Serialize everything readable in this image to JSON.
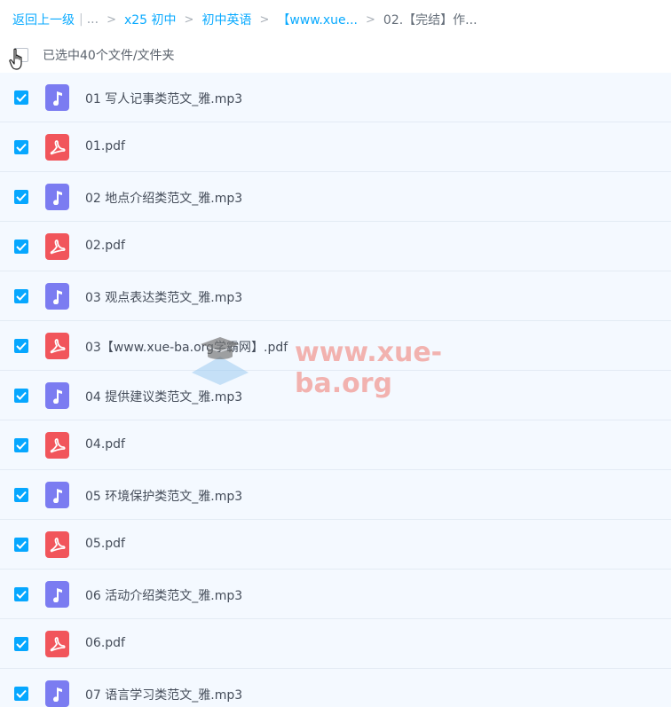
{
  "breadcrumb": {
    "back": "返回上一级",
    "ellipsis": "...",
    "items": [
      "x25 初中",
      "初中英语",
      "【www.xue..."
    ],
    "current": "02.【完结】作..."
  },
  "selection": {
    "text": "已选中40个文件/文件夹"
  },
  "files": [
    {
      "name": "01 写人记事类范文_雅.mp3",
      "type": "mp3"
    },
    {
      "name": "01.pdf",
      "type": "pdf"
    },
    {
      "name": "02 地点介绍类范文_雅.mp3",
      "type": "mp3"
    },
    {
      "name": "02.pdf",
      "type": "pdf"
    },
    {
      "name": "03 观点表达类范文_雅.mp3",
      "type": "mp3"
    },
    {
      "name": "03【www.xue-ba.org学霸网】.pdf",
      "type": "pdf"
    },
    {
      "name": "04 提供建议类范文_雅.mp3",
      "type": "mp3"
    },
    {
      "name": "04.pdf",
      "type": "pdf"
    },
    {
      "name": "05 环境保护类范文_雅.mp3",
      "type": "mp3"
    },
    {
      "name": "05.pdf",
      "type": "pdf"
    },
    {
      "name": "06 活动介绍类范文_雅.mp3",
      "type": "mp3"
    },
    {
      "name": "06.pdf",
      "type": "pdf"
    },
    {
      "name": "07 语言学习类范文_雅.mp3",
      "type": "mp3"
    }
  ],
  "watermark": {
    "text": "www.xue-ba.org"
  },
  "colors": {
    "accent": "#06a7ff",
    "mp3_icon": "#7b7cf1",
    "pdf_icon": "#f1555b",
    "list_bg": "#f4f9ff"
  },
  "icons": {
    "mp3": "music-note-icon",
    "pdf": "pdf-icon",
    "check": "check-icon"
  }
}
